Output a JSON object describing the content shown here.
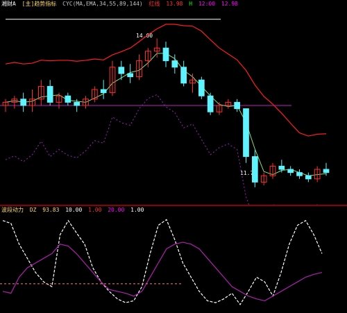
{
  "main_header": {
    "title": "湘财A",
    "indicator": "[主]趋势指标",
    "params": "CYC(MA,EMA,34,55,89,144)",
    "red_label": "红线",
    "value": "13.98",
    "highlight": "H",
    "other": "12:00",
    "end_value": "12.98"
  },
  "main_labels": {
    "high_price": "14.00",
    "low_price": "11.71"
  },
  "sub_header": {
    "title": "波段动力",
    "items": [
      {
        "label": "DZ",
        "value": "93.83",
        "color": "#ffd966"
      },
      {
        "label": "",
        "value": "10.00",
        "color": "#ffffff"
      },
      {
        "label": "",
        "value": "1.00",
        "color": "#ff3030"
      },
      {
        "label": "",
        "value": "20.00",
        "color": "#ff00ff"
      },
      {
        "label": "",
        "value": "1.00",
        "color": "#ffffff"
      }
    ]
  },
  "colors": {
    "up": "#ff3030",
    "down": "#5ff3ff",
    "slow_ma": "#ff1e1e",
    "purple_line": "#b020b0",
    "dotted_line": "#a020c0"
  },
  "chart_data": [
    {
      "type": "candlestick",
      "title": "",
      "candles": [
        {
          "o": 13.0,
          "h": 13.1,
          "l": 12.9,
          "c": 13.05
        },
        {
          "o": 13.05,
          "h": 13.15,
          "l": 12.95,
          "c": 13.1
        },
        {
          "o": 13.1,
          "h": 13.2,
          "l": 12.9,
          "c": 13.0
        },
        {
          "o": 13.0,
          "h": 13.25,
          "l": 12.9,
          "c": 13.1
        },
        {
          "o": 13.1,
          "h": 13.4,
          "l": 13.0,
          "c": 13.3
        },
        {
          "o": 13.3,
          "h": 13.4,
          "l": 13.0,
          "c": 13.05
        },
        {
          "o": 13.05,
          "h": 13.2,
          "l": 12.95,
          "c": 13.15
        },
        {
          "o": 13.15,
          "h": 13.2,
          "l": 13.0,
          "c": 13.05
        },
        {
          "o": 13.05,
          "h": 13.1,
          "l": 12.9,
          "c": 13.0
        },
        {
          "o": 13.0,
          "h": 13.15,
          "l": 12.95,
          "c": 13.1
        },
        {
          "o": 13.1,
          "h": 13.3,
          "l": 13.05,
          "c": 13.25
        },
        {
          "o": 13.25,
          "h": 13.4,
          "l": 13.1,
          "c": 13.2
        },
        {
          "o": 13.2,
          "h": 13.7,
          "l": 13.15,
          "c": 13.6
        },
        {
          "o": 13.6,
          "h": 13.7,
          "l": 13.4,
          "c": 13.5
        },
        {
          "o": 13.5,
          "h": 13.65,
          "l": 13.35,
          "c": 13.45
        },
        {
          "o": 13.45,
          "h": 13.8,
          "l": 13.4,
          "c": 13.7
        },
        {
          "o": 13.7,
          "h": 13.9,
          "l": 13.6,
          "c": 13.85
        },
        {
          "o": 13.85,
          "h": 14.05,
          "l": 13.75,
          "c": 13.9
        },
        {
          "o": 13.9,
          "h": 14.0,
          "l": 13.6,
          "c": 13.7
        },
        {
          "o": 13.7,
          "h": 13.8,
          "l": 13.5,
          "c": 13.6
        },
        {
          "o": 13.6,
          "h": 13.7,
          "l": 13.3,
          "c": 13.35
        },
        {
          "o": 13.35,
          "h": 13.5,
          "l": 13.2,
          "c": 13.4
        },
        {
          "o": 13.4,
          "h": 13.45,
          "l": 13.1,
          "c": 13.15
        },
        {
          "o": 13.15,
          "h": 13.2,
          "l": 12.85,
          "c": 12.9
        },
        {
          "o": 12.9,
          "h": 13.05,
          "l": 12.85,
          "c": 13.0
        },
        {
          "o": 13.0,
          "h": 13.1,
          "l": 12.95,
          "c": 13.05
        },
        {
          "o": 13.05,
          "h": 13.1,
          "l": 12.9,
          "c": 12.95
        },
        {
          "o": 12.95,
          "h": 12.95,
          "l": 12.1,
          "c": 12.2
        },
        {
          "o": 12.2,
          "h": 12.3,
          "l": 11.72,
          "c": 11.8
        },
        {
          "o": 11.8,
          "h": 11.95,
          "l": 11.75,
          "c": 11.9
        },
        {
          "o": 11.9,
          "h": 12.1,
          "l": 11.85,
          "c": 12.05
        },
        {
          "o": 12.05,
          "h": 12.15,
          "l": 11.95,
          "c": 12.0
        },
        {
          "o": 12.0,
          "h": 12.05,
          "l": 11.9,
          "c": 11.95
        },
        {
          "o": 11.95,
          "h": 12.0,
          "l": 11.85,
          "c": 11.9
        },
        {
          "o": 11.9,
          "h": 11.95,
          "l": 11.8,
          "c": 11.85
        },
        {
          "o": 11.85,
          "h": 12.05,
          "l": 11.8,
          "c": 12.0
        },
        {
          "o": 12.0,
          "h": 12.1,
          "l": 11.9,
          "c": 11.95
        }
      ],
      "ylim": [
        11.5,
        14.5
      ],
      "horizontal_lines": [
        {
          "value": 14.35,
          "color": "#ffffff"
        },
        {
          "value": 13.0,
          "color": "#c020c0"
        }
      ]
    },
    {
      "type": "line",
      "title": "",
      "ylim": [
        0,
        100
      ],
      "series": [
        {
          "values": [
            95,
            92,
            70,
            55,
            40,
            30,
            25,
            80,
            95,
            82,
            70,
            45,
            30,
            20,
            12,
            8,
            10,
            25,
            60,
            90,
            96,
            75,
            50,
            35,
            20,
            10,
            8,
            12,
            18,
            6,
            20,
            35,
            30,
            15,
            40,
            70,
            90,
            95,
            80,
            60
          ]
        },
        {
          "values": [
            20,
            18,
            35,
            45,
            50,
            55,
            60,
            70,
            68,
            60,
            50,
            40,
            30,
            22,
            20,
            18,
            15,
            20,
            35,
            50,
            65,
            70,
            72,
            70,
            65,
            55,
            45,
            35,
            25,
            20,
            15,
            12,
            10,
            15,
            20,
            25,
            30,
            35,
            38,
            40
          ]
        }
      ],
      "reference_value": 28
    }
  ]
}
